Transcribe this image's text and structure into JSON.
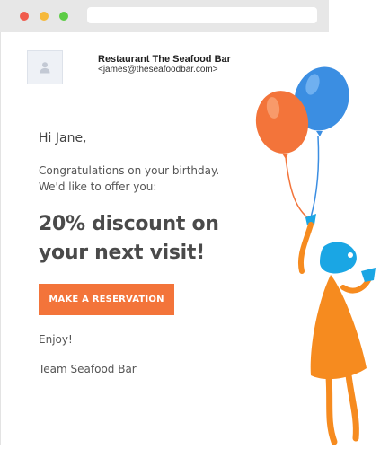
{
  "browser": {
    "controls": {
      "close_color": "#f05b4d",
      "minimize_color": "#f6b93b",
      "maximize_color": "#5ccc45"
    },
    "address_bar_value": ""
  },
  "email": {
    "sender_name": "Restaurant The Seafood Bar",
    "sender_email": "<james@theseafoodbar.com>",
    "avatar_icon": "person-icon",
    "greeting": "Hi Jane,",
    "body_line_1": "Congratulations on your birthday.",
    "body_line_2": "We'd like to offer you:",
    "offer_line_1": "20% discount on",
    "offer_line_2": "your next visit!",
    "cta_label": "MAKE A RESERVATION",
    "closing": "Enjoy!",
    "signature": "Team Seafood Bar"
  },
  "illustration": {
    "description_icon": "balloons-figure-illustration",
    "colors": {
      "orange_balloon": "#f3743a",
      "blue_balloon": "#3b8ee2",
      "figure_body": "#f68b1f",
      "figure_head": "#1aa6e4"
    }
  },
  "colors": {
    "accent": "#f3743a",
    "text": "#4a4a4a"
  }
}
